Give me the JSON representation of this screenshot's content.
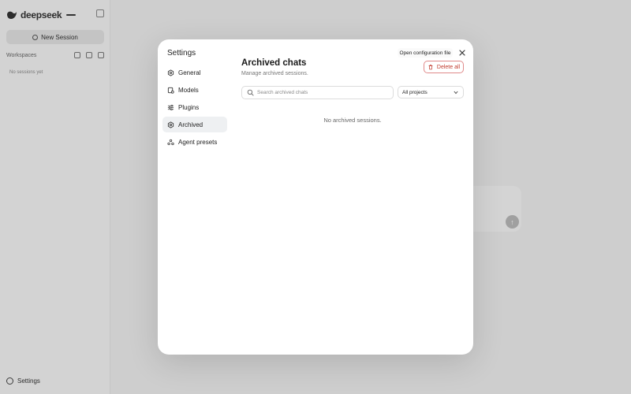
{
  "app": {
    "logo_text": "deepseek",
    "badge": "",
    "new_session_label": "New Session",
    "workspaces_label": "Workspaces",
    "no_sessions_text": "No sessions yet",
    "settings_label": "Settings",
    "send_glyph": "↑"
  },
  "modal": {
    "title": "Settings",
    "open_config_label": "Open configuration file",
    "close_icon": "close-icon",
    "nav": [
      {
        "id": "general",
        "label": "General",
        "icon": "hexagon-icon",
        "active": false
      },
      {
        "id": "models",
        "label": "Models",
        "icon": "models-icon",
        "active": false
      },
      {
        "id": "plugins",
        "label": "Plugins",
        "icon": "sliders-icon",
        "active": false
      },
      {
        "id": "archived",
        "label": "Archived",
        "icon": "archive-icon",
        "active": true
      },
      {
        "id": "agent-presets",
        "label": "Agent presets",
        "icon": "agent-icon",
        "active": false
      }
    ],
    "content": {
      "title": "Archived chats",
      "subtitle": "Manage archived sessions.",
      "delete_all_label": "Delete all",
      "search_placeholder": "Search archived chats",
      "search_value": "",
      "project_filter": "All projects",
      "empty_text": "No archived sessions."
    }
  },
  "colors": {
    "danger": "#c0392b",
    "danger_border": "#e08a8a",
    "active_nav_bg": "#eef0f2"
  }
}
